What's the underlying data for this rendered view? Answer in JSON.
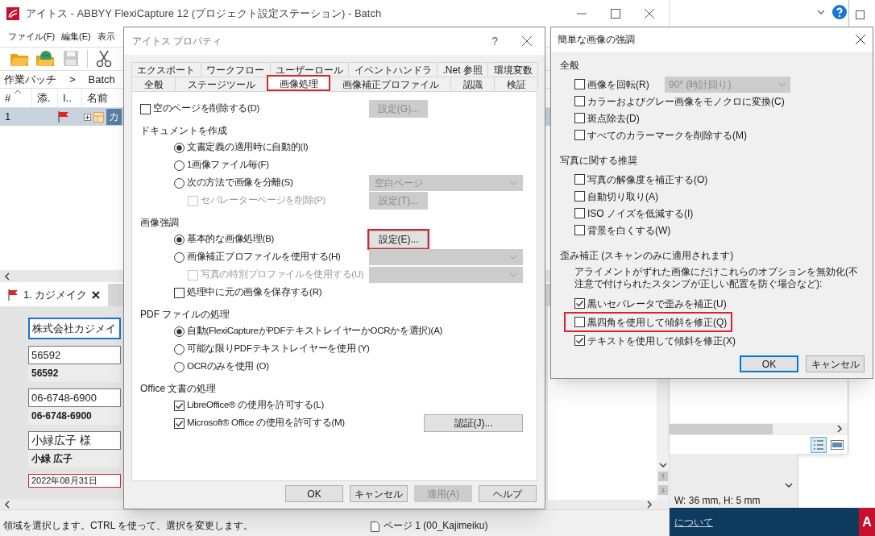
{
  "main_window": {
    "title": "アイトス - ABBYY FlexiCapture 12 (プロジェクト設定ステーション) - Batch",
    "menu": [
      "ファイル(F)",
      "編集(E)",
      "表示"
    ],
    "toolbar": [
      {
        "kind": "open"
      },
      {
        "kind": "web"
      },
      {
        "kind": "save"
      },
      {
        "kind": "cut"
      }
    ],
    "breadcrumb": [
      "作業バッチ",
      ">",
      "Batch"
    ],
    "columns": [
      "#",
      "添.",
      "I..",
      "名前"
    ],
    "rows": [
      {
        "number": "1",
        "flagged": true,
        "name": "カ",
        "selected": true
      }
    ],
    "document_tab": {
      "label": "1. カジメイク",
      "flagged": true
    },
    "fields": [
      {
        "value": "株式会社カジメイ",
        "focused": true,
        "error": false
      },
      {
        "value": "56592",
        "recognized": "56592",
        "focused": false,
        "error": false
      },
      {
        "value": "06-6748-6900",
        "recognized": "06-6748-6900",
        "focused": false,
        "error": false
      },
      {
        "value": "小緑広子 様",
        "recognized": "小緑 広子",
        "focused": false,
        "error": false
      },
      {
        "value": "2022年08月31日",
        "focused": false,
        "error": true
      }
    ],
    "status_text": "領域を選択します。CTRL を使って、選択を変更します。",
    "page_status": "ページ 1 (00_Kajimeiku)"
  },
  "properties_dialog": {
    "title": "アイトス プロパティ",
    "help": "?",
    "tab_rows": [
      [
        {
          "label": "エクスポート",
          "selected": false,
          "highlighted": false
        },
        {
          "label": "ワークフロー",
          "selected": false,
          "highlighted": false
        },
        {
          "label": "ユーザーロール",
          "selected": false,
          "highlighted": false
        },
        {
          "label": "イベントハンドラ",
          "selected": false,
          "highlighted": false
        },
        {
          "label": ".Net 参照",
          "selected": false,
          "highlighted": false
        },
        {
          "label": "環境変数",
          "selected": false,
          "highlighted": false
        }
      ],
      [
        {
          "label": "全般",
          "selected": false,
          "highlighted": false
        },
        {
          "label": "ステージツール",
          "selected": false,
          "highlighted": false
        },
        {
          "label": "画像処理",
          "selected": true,
          "highlighted": true
        },
        {
          "label": "画像補正プロファイル",
          "selected": false,
          "highlighted": false
        },
        {
          "label": "認識",
          "selected": false,
          "highlighted": false
        },
        {
          "label": "検証",
          "selected": false,
          "highlighted": false
        }
      ]
    ],
    "items": [
      {
        "kind": "checkbox",
        "label": "空のページを削除する(D)",
        "checked": false,
        "disabled": false,
        "side": {
          "kind": "button",
          "label": "設定(G)...",
          "disabled": true,
          "highlighted": false
        }
      },
      {
        "kind": "group",
        "label": "ドキュメントを作成",
        "children": [
          {
            "kind": "radio",
            "label": "文書定義の適用時に自動的(I)",
            "selected": true,
            "disabled": false
          },
          {
            "kind": "radio",
            "label": "1画像ファイル毎(F)",
            "selected": false,
            "disabled": false
          },
          {
            "kind": "radio",
            "label": "次の方法で画像を分離(S)",
            "selected": false,
            "disabled": false,
            "side": {
              "kind": "dropdown",
              "value": "空白ページ",
              "disabled": true
            },
            "children": [
              {
                "kind": "checkbox",
                "label": "セパレーターページを削除(P)",
                "checked": false,
                "disabled": true,
                "side": {
                  "kind": "button",
                  "label": "設定(T)...",
                  "disabled": true,
                  "highlighted": false
                }
              }
            ]
          }
        ]
      },
      {
        "kind": "group",
        "label": "画像強調",
        "children": [
          {
            "kind": "radio",
            "label": "基本的な画像処理(B)",
            "selected": true,
            "disabled": false,
            "side": {
              "kind": "button",
              "label": "設定(E)...",
              "disabled": false,
              "highlighted": true
            }
          },
          {
            "kind": "radio",
            "label": "画像補正プロファイルを使用する(H)",
            "selected": false,
            "disabled": false,
            "side": {
              "kind": "dropdown",
              "disabled": true
            },
            "children": [
              {
                "kind": "checkbox",
                "label": "写真の特別プロファイルを使用する(U)",
                "checked": false,
                "disabled": true,
                "side": {
                  "kind": "dropdown",
                  "disabled": true
                }
              }
            ]
          },
          {
            "kind": "checkbox",
            "label": "処理中に元の画像を保存する(R)",
            "checked": false,
            "disabled": false
          }
        ]
      },
      {
        "kind": "group",
        "label": "PDF ファイルの処理",
        "children": [
          {
            "kind": "radio",
            "label": "自動(FlexiCaptureがPDFテキストレイヤーかOCRかを選択)(A)",
            "selected": true,
            "disabled": false
          },
          {
            "kind": "radio",
            "label": "可能な限りPDFテキストレイヤーを使用 (Y)",
            "selected": false,
            "disabled": false
          },
          {
            "kind": "radio",
            "label": "OCRのみを使用 (O)",
            "selected": false,
            "disabled": false
          }
        ]
      },
      {
        "kind": "group",
        "label": "Office 文書の処理",
        "children": [
          {
            "kind": "checkbox",
            "label": "LibreOffice® の使用を許可する(L)",
            "checked": true,
            "disabled": false
          },
          {
            "kind": "checkbox",
            "label": "Microsoft® Office の使用を許可する(M)",
            "checked": true,
            "disabled": false,
            "side": {
              "kind": "wide_button",
              "label": "認証(J)...",
              "disabled": false,
              "highlighted": false
            }
          }
        ]
      }
    ],
    "buttons": [
      {
        "label": "OK",
        "disabled": false
      },
      {
        "label": "キャンセル",
        "disabled": false
      },
      {
        "label": "適用(A)",
        "disabled": true
      },
      {
        "label": "ヘルプ",
        "disabled": false
      }
    ]
  },
  "enhancement_dialog": {
    "title": "簡単な画像の強調",
    "sections": [
      {
        "heading": "全般",
        "options": [
          {
            "label": "画像を回転(R)",
            "checked": false,
            "highlighted": false,
            "dropdown": {
              "value": "90° (時計回り)",
              "disabled": true
            }
          },
          {
            "label": "カラーおよびグレー画像をモノクロに変換(C)",
            "checked": false,
            "highlighted": false
          },
          {
            "label": "斑点除去(D)",
            "checked": false,
            "highlighted": false
          },
          {
            "label": "すべてのカラーマークを削除する(M)",
            "checked": false,
            "highlighted": false
          }
        ]
      },
      {
        "heading": "写真に関する推奨",
        "options": [
          {
            "label": "写真の解像度を補正する(O)",
            "checked": false,
            "highlighted": false
          },
          {
            "label": "自動切り取り(A)",
            "checked": false,
            "highlighted": false
          },
          {
            "label": "ISO ノイズを低減する(I)",
            "checked": false,
            "highlighted": false
          },
          {
            "label": "背景を白くする(W)",
            "checked": false,
            "highlighted": false
          }
        ]
      },
      {
        "heading": "歪み補正 (スキャンのみに適用されます)",
        "note": "アライメントがずれた画像にだけこれらのオプションを無効化(不注意で付けられたスタンプが正しい配置を防ぐ場合など):",
        "options": [
          {
            "label": "黒いセパレータで歪みを補正(U)",
            "checked": true,
            "highlighted": false
          },
          {
            "label": "黒四角を使用して傾斜を修正(Q)",
            "checked": false,
            "highlighted": true
          },
          {
            "label": "テキストを使用して傾斜を修正(X)",
            "checked": true,
            "highlighted": false
          }
        ]
      }
    ],
    "buttons": [
      {
        "label": "OK",
        "default": true
      },
      {
        "label": "キャンセル",
        "default": false
      }
    ]
  },
  "background_window": {
    "size_readout": "W: 36 mm, H: 5 mm",
    "taskbar_link": "について",
    "taskbar_badge": "A"
  }
}
